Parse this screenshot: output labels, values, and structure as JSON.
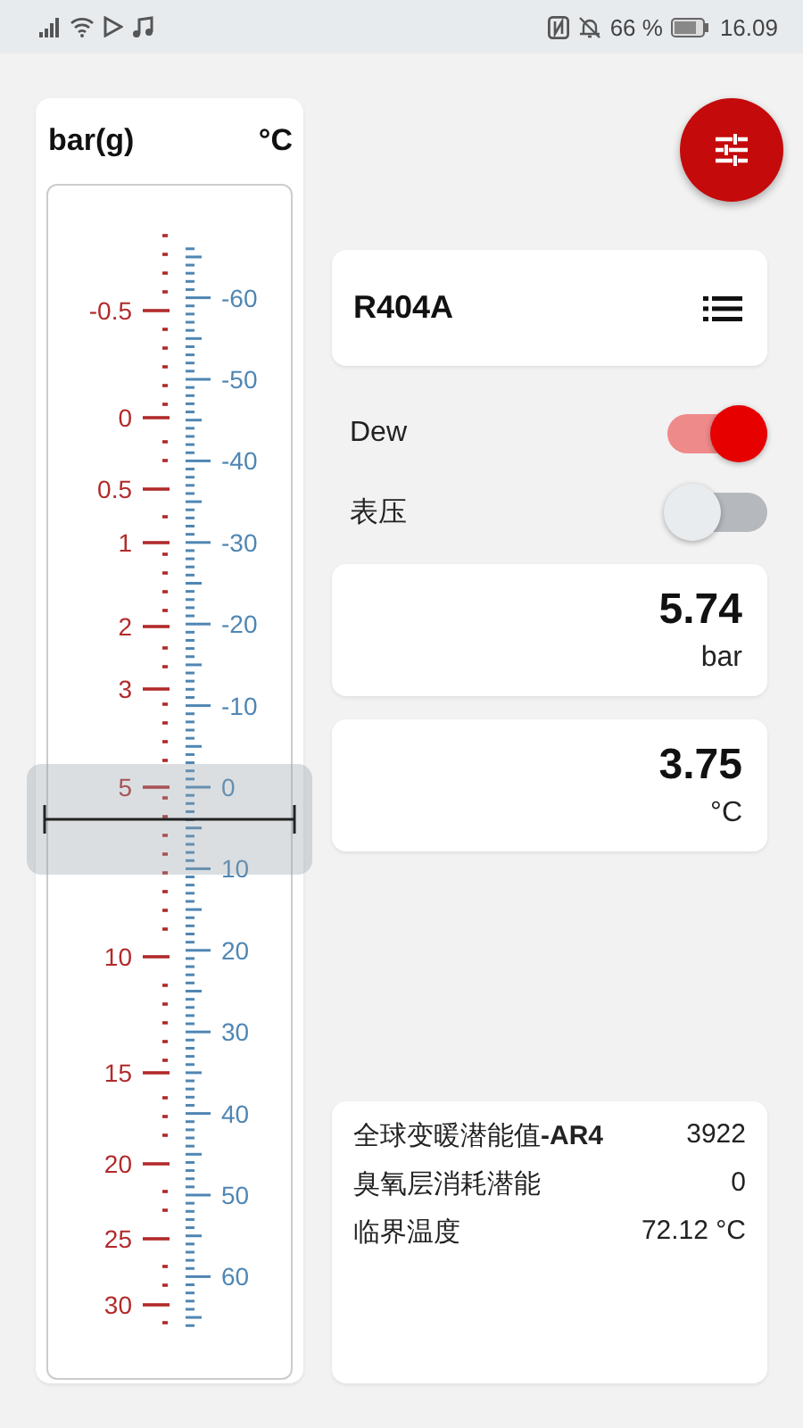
{
  "status_bar": {
    "battery_percent": "66 %",
    "time": "16.09"
  },
  "gauge": {
    "pressure_unit": "bar(g)",
    "temperature_unit": "°C",
    "pressure_labels": [
      "-0.5",
      "0",
      "0.5",
      "1",
      "2",
      "3",
      "5",
      "10",
      "15",
      "20",
      "25",
      "30"
    ],
    "temperature_labels": [
      "-60",
      "-50",
      "-40",
      "-30",
      "-20",
      "-10",
      "0",
      "10",
      "20",
      "30",
      "40",
      "50",
      "60"
    ]
  },
  "refrigerant": {
    "name": "R404A"
  },
  "switches": [
    {
      "label": "Dew",
      "on": true
    },
    {
      "label": "表压",
      "on": false
    }
  ],
  "readings": [
    {
      "value": "5.74",
      "unit": "bar"
    },
    {
      "value": "3.75",
      "unit": "°C"
    }
  ],
  "properties": [
    {
      "label": "全球变暖潜能值**-AR4**",
      "value": "3922"
    },
    {
      "label": "臭氧层消耗潜能",
      "value": "0"
    },
    {
      "label": "临界温度",
      "value": "72.12 °C"
    }
  ]
}
